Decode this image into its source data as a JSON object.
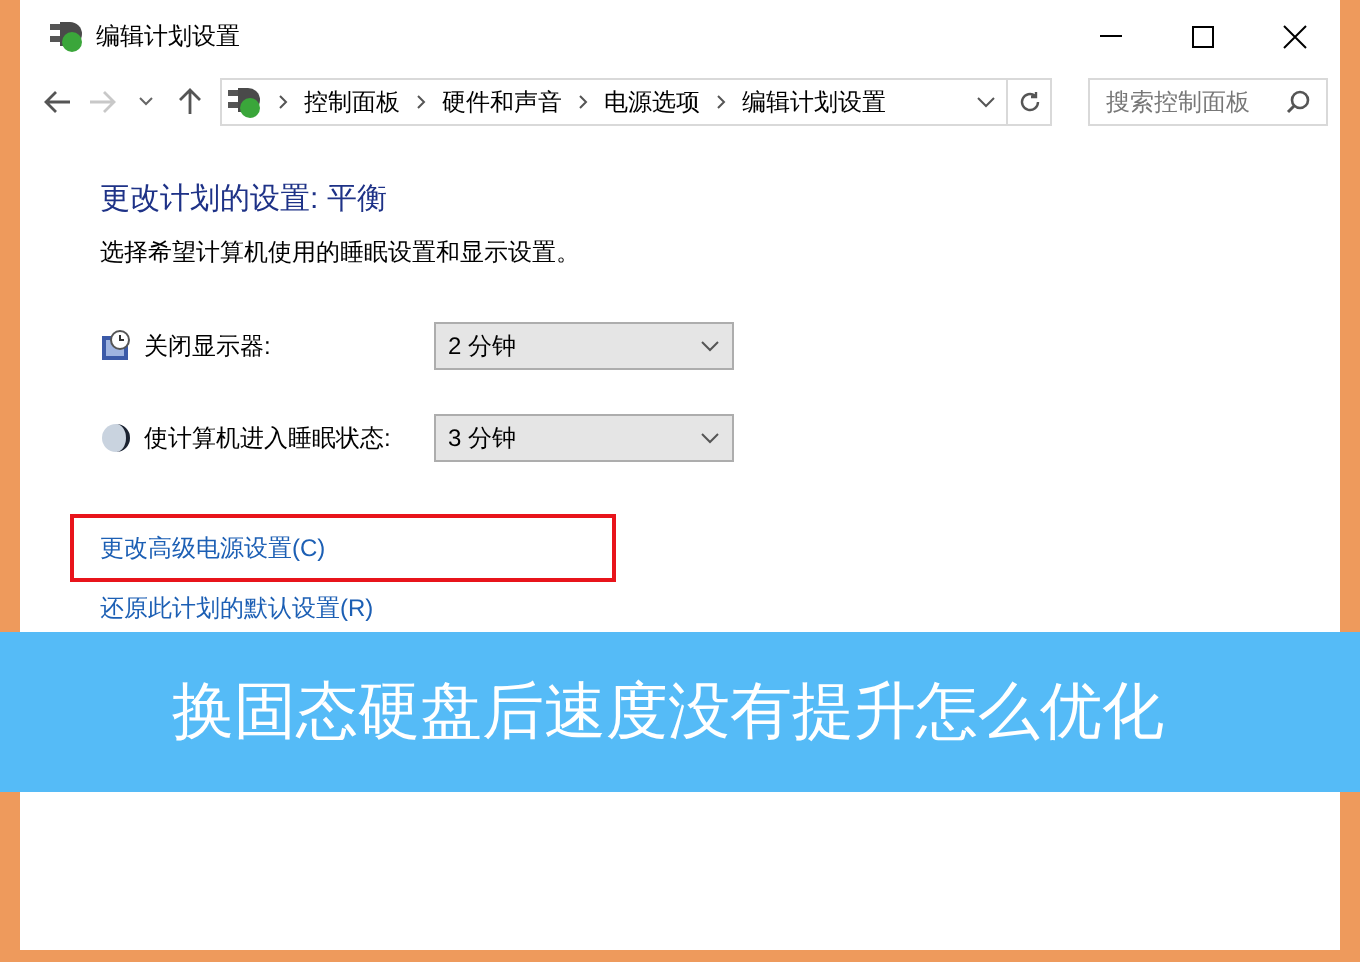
{
  "window": {
    "title": "编辑计划设置"
  },
  "address_bar": {
    "back_enabled": true,
    "forward_enabled": false,
    "crumbs": [
      "控制面板",
      "硬件和声音",
      "电源选项",
      "编辑计划设置"
    ]
  },
  "search": {
    "placeholder": "搜索控制面板"
  },
  "heading": "更改计划的设置: 平衡",
  "description": "选择希望计算机使用的睡眠设置和显示设置。",
  "settings": [
    {
      "kind": "display",
      "label": "关闭显示器:",
      "value": "2 分钟"
    },
    {
      "kind": "sleep",
      "label": "使计算机进入睡眠状态:",
      "value": "3 分钟"
    }
  ],
  "links": [
    {
      "text": "更改高级电源设置(C)",
      "highlighted": true
    },
    {
      "text": "还原此计划的默认设置(R)",
      "highlighted": false
    }
  ],
  "overlay_banner": {
    "text": "换固态硬盘后速度没有提升怎么优化"
  }
}
